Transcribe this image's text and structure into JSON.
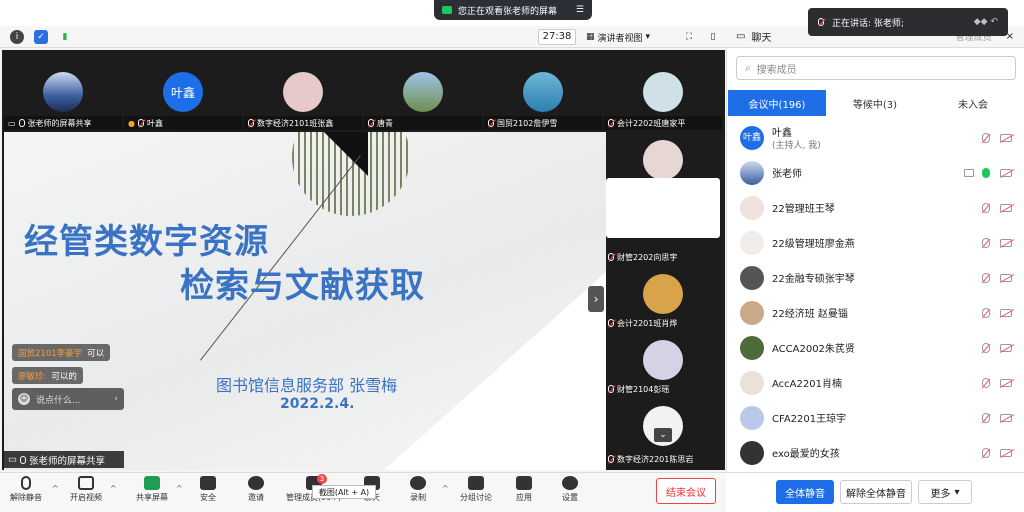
{
  "top": {
    "sharing_notice": "您正在观看张老师的屏幕",
    "speaking_notice": "正在讲话: 张老师;",
    "timer": "27:38",
    "view_mode": "演讲者视图"
  },
  "tiles": [
    {
      "name": "张老师的屏幕共享",
      "avatar_text": ""
    },
    {
      "name": "叶鑫",
      "avatar_text": "叶鑫"
    },
    {
      "name": "数字经济2101班张鑫",
      "avatar_text": ""
    },
    {
      "name": "唐青",
      "avatar_text": ""
    },
    {
      "name": "国贸2102詹伊雪",
      "avatar_text": ""
    },
    {
      "name": "会计2202班唐家平",
      "avatar_text": ""
    }
  ],
  "slide": {
    "title_line1": "经管类数字资源",
    "title_line2": "检索与文献获取",
    "department": "图书馆信息服务部   张雪梅",
    "date": "2022.2.4."
  },
  "chat": {
    "messages": [
      {
        "who": "国贸2101李豪宇",
        "text": "可以"
      },
      {
        "who": "廖敏珍:",
        "text": "可以的"
      }
    ],
    "input_placeholder": "说点什么..."
  },
  "screen_share_label": "张老师的屏幕共享",
  "right_tiles": [
    {
      "name": "财管2202向思宇"
    },
    {
      "name": "会计2201班肖烨"
    },
    {
      "name": "财管2104彭瑶"
    },
    {
      "name": "数字经济2201陈思岩"
    }
  ],
  "toolbar": {
    "unmute": "解除静音",
    "start_video": "开启视频",
    "share_screen": "共享屏幕",
    "security": "安全",
    "invite": "邀请",
    "manage_members": "管理成员(99+)",
    "chat": "聊天",
    "record": "录制",
    "breakout": "分组讨论",
    "apps": "应用",
    "settings": "设置",
    "end_meeting": "结束会议",
    "tooltip": "截图(Alt + A)",
    "badge": "3"
  },
  "panel": {
    "header_title": "聊天",
    "header_ghost": "管理成员",
    "search_placeholder": "搜索成员",
    "tabs": [
      "会议中(196)",
      "等候中(3)",
      "未入会"
    ],
    "members": [
      {
        "name": "叶鑫",
        "sub": "(主持人, 我)",
        "mic": "off",
        "cam": true,
        "screen": false
      },
      {
        "name": "张老师",
        "sub": "",
        "mic": "on",
        "cam": true,
        "screen": true
      },
      {
        "name": "22管理班王琴",
        "sub": "",
        "mic": "off",
        "cam": true,
        "screen": false
      },
      {
        "name": "22级管理班廖金燕",
        "sub": "",
        "mic": "off",
        "cam": true,
        "screen": false
      },
      {
        "name": "22金融专硕张宇琴",
        "sub": "",
        "mic": "off",
        "cam": true,
        "screen": false
      },
      {
        "name": "22经济班 赵曼锱",
        "sub": "",
        "mic": "off",
        "cam": true,
        "screen": false
      },
      {
        "name": "ACCA2002朱芪贤",
        "sub": "",
        "mic": "off",
        "cam": true,
        "screen": false
      },
      {
        "name": "AccA2201肖楠",
        "sub": "",
        "mic": "off",
        "cam": true,
        "screen": false
      },
      {
        "name": "CFA2201王琼宇",
        "sub": "",
        "mic": "off",
        "cam": true,
        "screen": false
      },
      {
        "name": "exo最爱的女孩",
        "sub": "",
        "mic": "off",
        "cam": true,
        "screen": false
      }
    ],
    "mute_all": "全体静音",
    "unmute_all": "解除全体静音",
    "more": "更多"
  },
  "colors": {
    "accent": "#1e6ee8",
    "slide_title": "#3a73c4",
    "end_red": "#e33333"
  }
}
